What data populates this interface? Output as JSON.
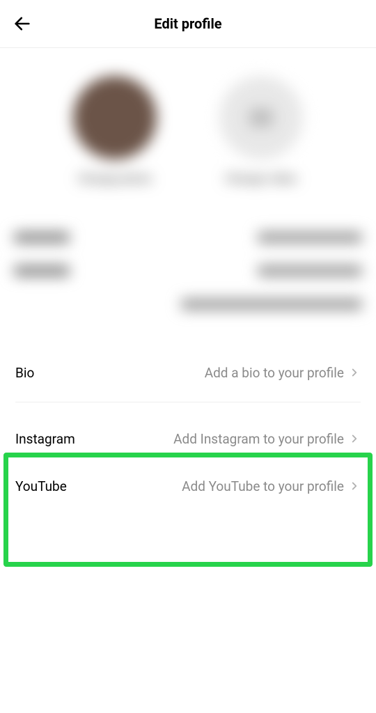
{
  "header": {
    "title": "Edit profile"
  },
  "avatars": {
    "photo_label": "Change photo",
    "video_label": "Change video"
  },
  "blurred_fields": {
    "name_label": "Name",
    "name_value": "Emma Mallory",
    "username_label": "Username",
    "username_value": "emmamallory"
  },
  "bio": {
    "label": "Bio",
    "placeholder": "Add a bio to your profile"
  },
  "social": {
    "instagram": {
      "label": "Instagram",
      "placeholder": "Add Instagram to your profile"
    },
    "youtube": {
      "label": "YouTube",
      "placeholder": "Add YouTube to your profile"
    }
  }
}
